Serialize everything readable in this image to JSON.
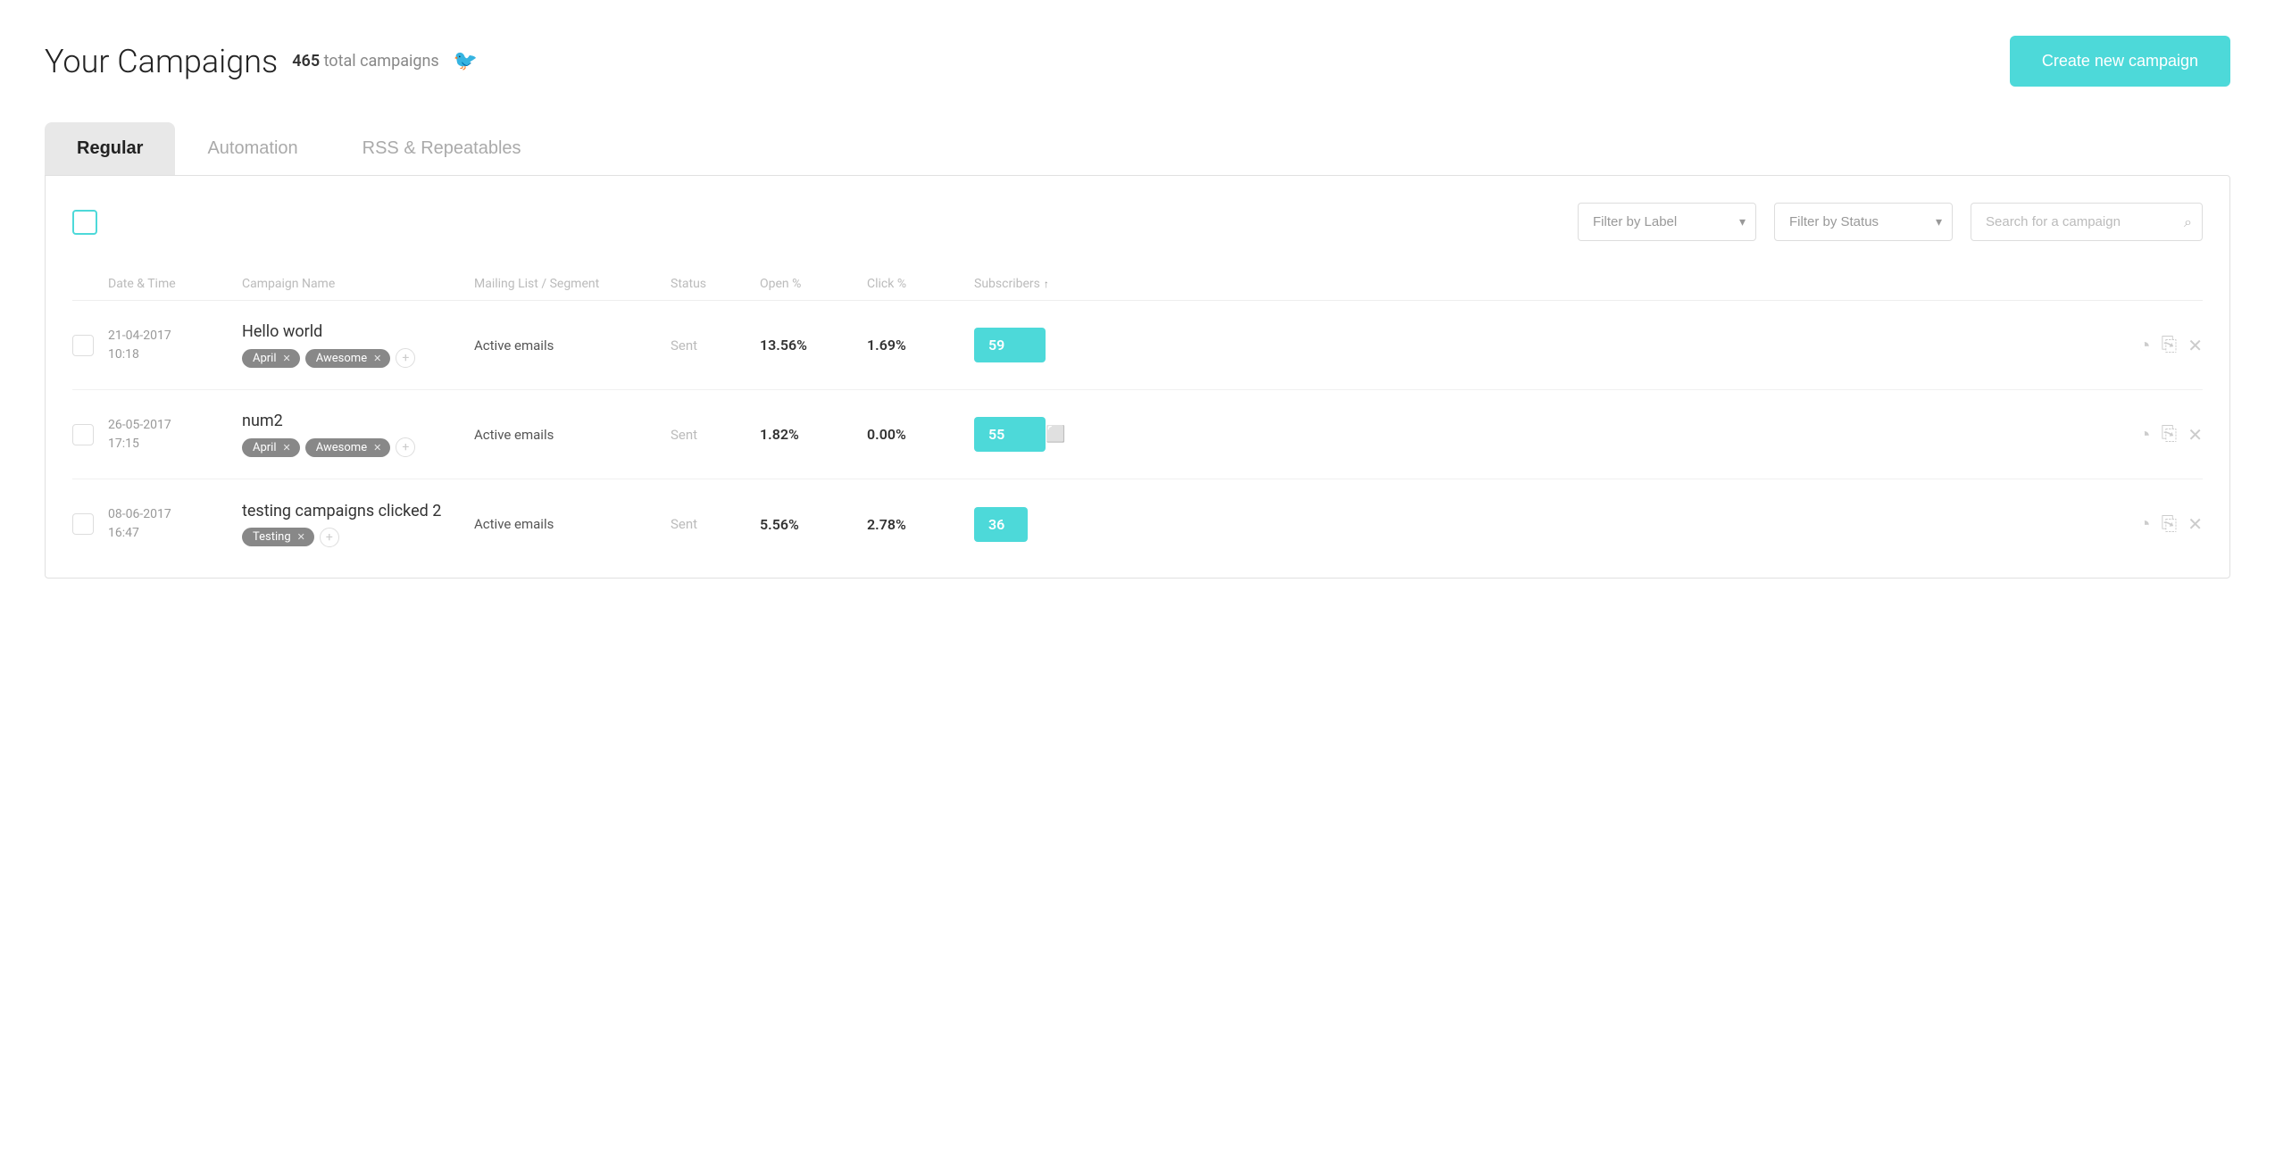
{
  "page": {
    "title": "Your Campaigns",
    "count": "465",
    "count_label": "total campaigns"
  },
  "header": {
    "create_button": "Create new campaign"
  },
  "tabs": [
    {
      "id": "regular",
      "label": "Regular",
      "active": true
    },
    {
      "id": "automation",
      "label": "Automation",
      "active": false
    },
    {
      "id": "rss",
      "label": "RSS & Repeatables",
      "active": false
    }
  ],
  "filters": {
    "label_placeholder": "Filter by Label",
    "status_placeholder": "Filter by Status",
    "search_placeholder": "Search for a campaign"
  },
  "table": {
    "headers": [
      {
        "id": "date",
        "label": "Date & Time"
      },
      {
        "id": "name",
        "label": "Campaign Name"
      },
      {
        "id": "mailing",
        "label": "Mailing List / Segment"
      },
      {
        "id": "status",
        "label": "Status"
      },
      {
        "id": "open",
        "label": "Open %"
      },
      {
        "id": "click",
        "label": "Click %"
      },
      {
        "id": "subscribers",
        "label": "Subscribers",
        "sortable": true,
        "sort_dir": "asc"
      }
    ],
    "rows": [
      {
        "id": 1,
        "date": "21-04-2017",
        "time": "10:18",
        "name": "Hello world",
        "tags": [
          "April",
          "Awesome"
        ],
        "mailing": "Active emails",
        "status": "Sent",
        "open_pct": "13.56%",
        "click_pct": "1.69%",
        "subscribers": "59"
      },
      {
        "id": 2,
        "date": "26-05-2017",
        "time": "17:15",
        "name": "num2",
        "tags": [
          "April",
          "Awesome"
        ],
        "mailing": "Active emails",
        "status": "Sent",
        "open_pct": "1.82%",
        "click_pct": "0.00%",
        "subscribers": "55"
      },
      {
        "id": 3,
        "date": "08-06-2017",
        "time": "16:47",
        "name": "testing campaigns clicked 2",
        "tags": [
          "Testing"
        ],
        "mailing": "Active emails",
        "status": "Sent",
        "open_pct": "5.56%",
        "click_pct": "2.78%",
        "subscribers": "36"
      }
    ]
  },
  "colors": {
    "accent": "#4dd9d9",
    "tag_bg": "#888888"
  }
}
